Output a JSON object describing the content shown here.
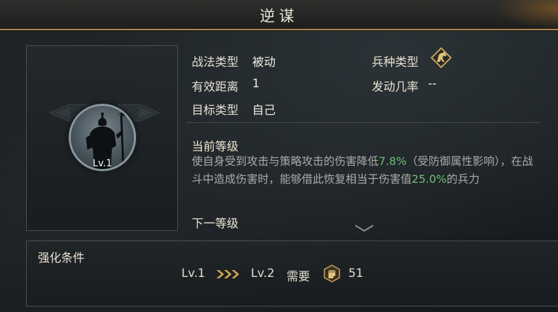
{
  "title": "逆谋",
  "info": {
    "tactic_type_label": "战法类型",
    "tactic_type_value": "被动",
    "range_label": "有效距离",
    "range_value": "1",
    "target_label": "目标类型",
    "target_value": "自己",
    "troop_type_label": "兵种类型",
    "trigger_rate_label": "发动几率",
    "trigger_rate_value": "--"
  },
  "portrait": {
    "level": "Lv.1"
  },
  "current_level": {
    "heading": "当前等级",
    "desc_part1": "使自身受到攻击与策略攻击的伤害降低",
    "desc_value1": "7.8%",
    "desc_part2": "（受防御属性影响），在战斗中造成伤害时，能够借此恢复相当于伤害值",
    "desc_value2": "25.0%",
    "desc_part3": "的兵力"
  },
  "next_level": {
    "heading": "下一等级"
  },
  "upgrade": {
    "heading": "强化条件",
    "from_level": "Lv.1",
    "to_level": "Lv.2",
    "need_label": "需要",
    "cost": "51"
  },
  "colors": {
    "accent_gold": "#b08a4a",
    "highlight_green": "#6fbf73"
  },
  "icons": {
    "troop_type": "horse-cavalry-icon",
    "cost": "fist-token-icon",
    "arrows": "triple-chevron-right-icon",
    "expand": "chevron-down-icon"
  }
}
